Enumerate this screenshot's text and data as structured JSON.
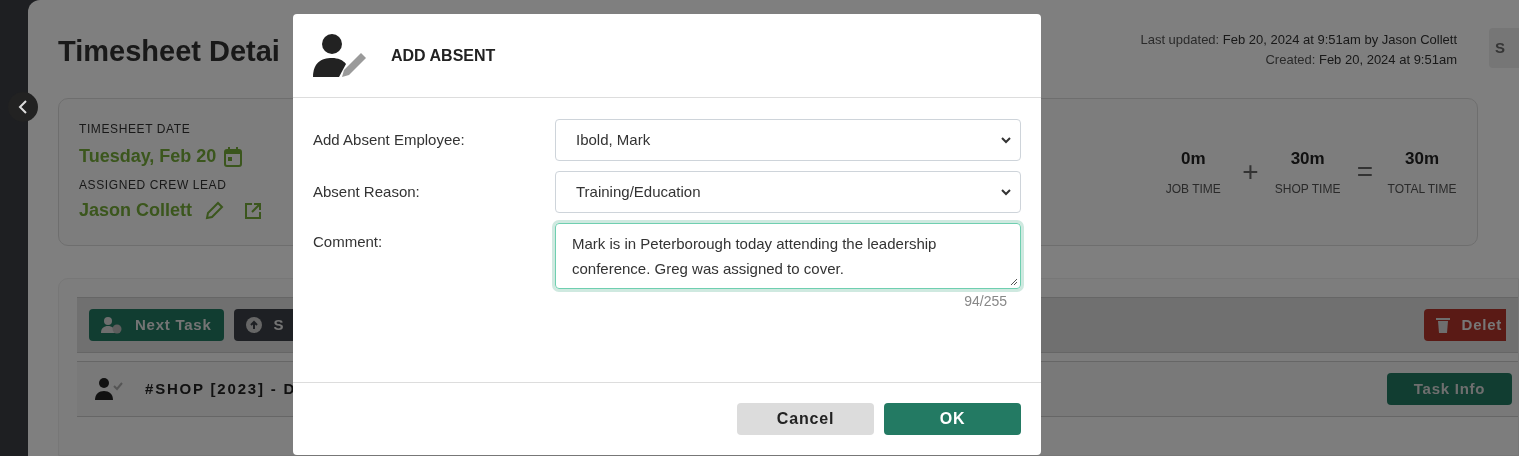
{
  "page": {
    "title": "Timesheet Detai",
    "last_updated": {
      "label": "Last updated:",
      "value": "Feb 20, 2024 at 9:51am by Jason Collett"
    },
    "created": {
      "label": "Created:",
      "value": "Feb 20, 2024 at 9:51am"
    },
    "corner_button": "S"
  },
  "summary": {
    "date_label": "TIMESHEET DATE",
    "date": "Tuesday, Feb 20",
    "crew_lead_label": "ASSIGNED CREW LEAD",
    "crew_lead": "Jason Collett",
    "times": [
      {
        "value": "0m",
        "label": "JOB TIME"
      },
      {
        "value": "30m",
        "label": "SHOP TIME"
      },
      {
        "value": "30m",
        "label": "TOTAL TIME"
      }
    ],
    "operators": [
      "+",
      "="
    ]
  },
  "toolbar": {
    "buttons": [
      {
        "kind": "next",
        "label": "Next Task"
      },
      {
        "kind": "upload",
        "label": "S"
      }
    ],
    "delete_button": "Delet"
  },
  "tasks": [
    {
      "title": "#SHOP [2023] - D",
      "button": "Task Info"
    }
  ],
  "dialog": {
    "title": "ADD ABSENT",
    "fields": [
      {
        "kind": "select",
        "label": "Add Absent Employee:",
        "value": "Ibold, Mark",
        "focused": false
      },
      {
        "kind": "select",
        "label": "Absent Reason:",
        "value": "Training/Education",
        "focused": false
      },
      {
        "kind": "textarea",
        "label": "Comment:",
        "value": "Mark is in Peterborough today attending the leadership conference. Greg was assigned to cover.",
        "focused": true,
        "counter": "94/255"
      }
    ],
    "buttons": [
      {
        "kind": "secondary",
        "label": "Cancel"
      },
      {
        "kind": "primary",
        "label": "OK"
      }
    ]
  }
}
